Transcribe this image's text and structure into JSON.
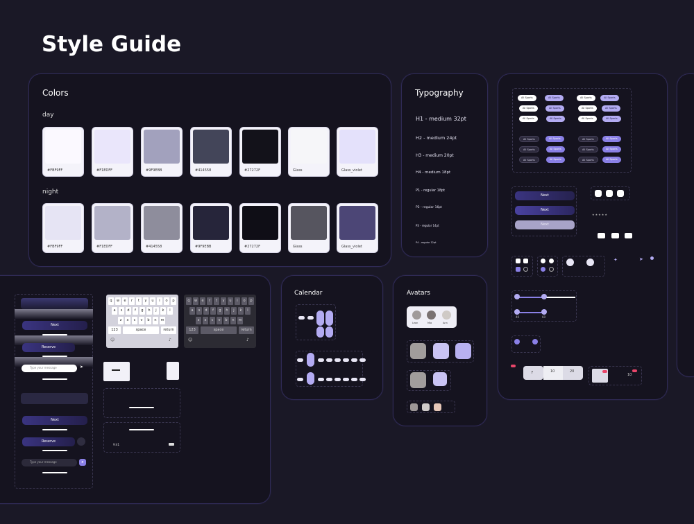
{
  "page": {
    "title": "Style Guide"
  },
  "colors": {
    "title": "Colors",
    "day_label": "day",
    "night_label": "night",
    "day": [
      {
        "name": "#FBF9FF",
        "hex": "#fbf9ff"
      },
      {
        "name": "#F1EDFF",
        "hex": "#eae6fb"
      },
      {
        "name": "#9F9EBB",
        "hex": "#a2a1bd"
      },
      {
        "name": "#414558",
        "hex": "#434559"
      },
      {
        "name": "#27272F",
        "hex": "#13121a"
      },
      {
        "name": "Glass",
        "hex": "#f6f6f9"
      },
      {
        "name": "Glass_violet",
        "hex": "#e4e1fb"
      }
    ],
    "night": [
      {
        "name": "#FBF9FF",
        "hex": "#e6e4f4"
      },
      {
        "name": "#F1EDFF",
        "hex": "#b3b2c8"
      },
      {
        "name": "#414558",
        "hex": "#8e8d9c"
      },
      {
        "name": "#9F9EBB",
        "hex": "#26253a"
      },
      {
        "name": "#27272F",
        "hex": "#0f0e16"
      },
      {
        "name": "Glass",
        "hex": "#56555f"
      },
      {
        "name": "Glass_violet",
        "hex": "#4c4676"
      }
    ]
  },
  "typography": {
    "title": "Typography",
    "items": [
      "H1 - medium 32pt",
      "H2 - medium 24pt",
      "H3 - medium 20pt",
      "H4 - medium 18pt",
      "P1 - regular 18pt",
      "P2 - regular 16pt",
      "P3 - regular 14pt",
      "P4 - regular 12pt"
    ]
  },
  "chips": {
    "label": "All Sports"
  },
  "buttons": {
    "next": "Next",
    "reserve": "Reserve"
  },
  "message": {
    "placeholder": "Type your message"
  },
  "keyboard": {
    "row1": [
      "q",
      "w",
      "e",
      "r",
      "t",
      "y",
      "u",
      "i",
      "o",
      "p"
    ],
    "row2": [
      "a",
      "s",
      "d",
      "f",
      "g",
      "h",
      "j",
      "k",
      "l"
    ],
    "row3": [
      "z",
      "x",
      "c",
      "v",
      "b",
      "n",
      "m"
    ],
    "numbers": "123",
    "space": "space",
    "return": "return"
  },
  "status": {
    "time": "9:41"
  },
  "calendar": {
    "title": "Calendar"
  },
  "avatars": {
    "title": "Avatars",
    "names": [
      "Leon",
      "Mia",
      "Ann"
    ]
  },
  "sliders": {
    "min": "40",
    "max": "60"
  },
  "counters": {
    "a": "7",
    "b": "10",
    "c": "20",
    "d": "10"
  },
  "accent": "#8a80e6",
  "border": "#2f2a55"
}
